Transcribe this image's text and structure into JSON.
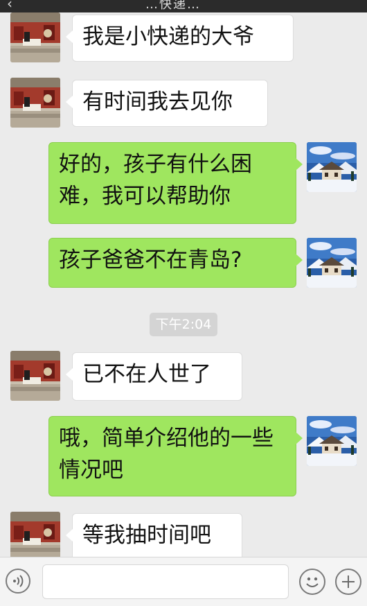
{
  "header": {
    "back_glyph": "‹",
    "title": "…快递…"
  },
  "messages": [
    {
      "side": "in",
      "text": "我是小快递的大爷"
    },
    {
      "side": "in",
      "text": "有时间我去见你"
    },
    {
      "side": "out",
      "text": "好的，孩子有什么困难，我可以帮助你"
    },
    {
      "side": "out",
      "text": "孩子爸爸不在青岛?"
    },
    {
      "side": "in",
      "text": "已不在人世了"
    },
    {
      "side": "out",
      "text": "哦，简单介绍他的一些情况吧"
    },
    {
      "side": "in",
      "text": "等我抽时间吧"
    }
  ],
  "timestamp": "下午2:04",
  "input": {
    "value": "",
    "voice_icon": "voice-icon",
    "emoji_icon": "emoji-icon",
    "plus_icon": "plus-icon"
  },
  "colors": {
    "background": "#ebebeb",
    "incoming_bubble": "#ffffff",
    "outgoing_bubble": "#9fe65f",
    "timestamp_bg": "#d4d4d4"
  }
}
